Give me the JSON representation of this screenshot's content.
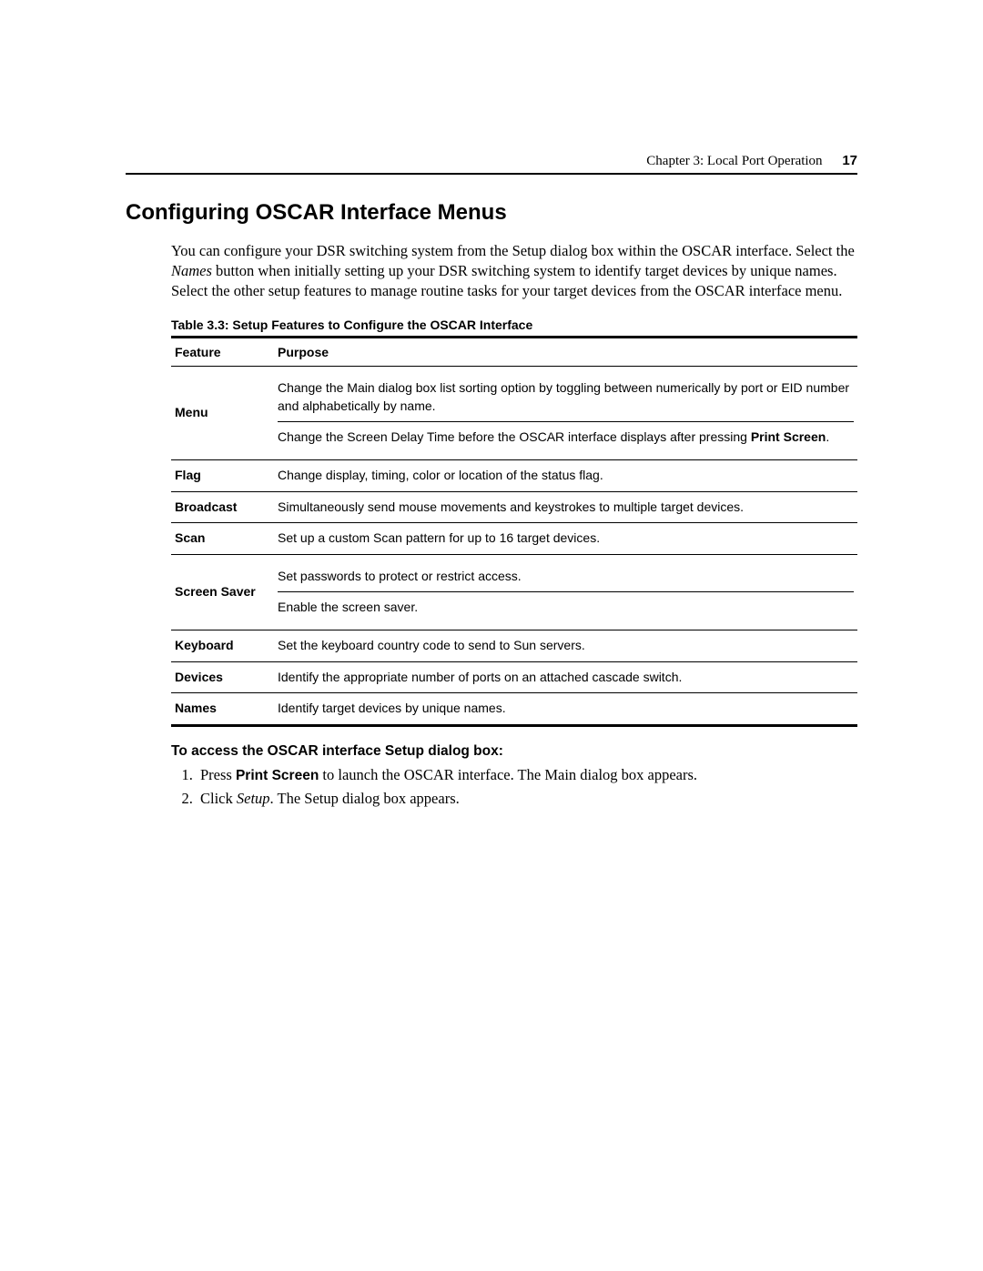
{
  "header": {
    "chapter": "Chapter 3: Local Port Operation",
    "page": "17"
  },
  "title": "Configuring OSCAR Interface Menus",
  "intro": {
    "pre": "You can configure your DSR switching system from the Setup dialog box within the OSCAR interface. Select the ",
    "em": "Names",
    "post": " button when initially setting up your DSR switching system to identify target devices by unique names. Select the other setup features to manage routine tasks for your target devices from the OSCAR interface menu."
  },
  "table": {
    "caption": "Table 3.3: Setup Features to Configure the OSCAR Interface",
    "head_feature": "Feature",
    "head_purpose": "Purpose",
    "rows": [
      {
        "feature": "Menu",
        "purposes": [
          {
            "pre": "Change the Main dialog box list sorting option by toggling between numerically by port or EID number and alphabetically by name.",
            "strong": "",
            "post": ""
          },
          {
            "pre": "Change the Screen Delay Time before the OSCAR interface displays after pressing ",
            "strong": "Print Screen",
            "post": "."
          }
        ]
      },
      {
        "feature": "Flag",
        "purposes": [
          {
            "pre": "Change display, timing, color or location of the status flag.",
            "strong": "",
            "post": ""
          }
        ]
      },
      {
        "feature": "Broadcast",
        "purposes": [
          {
            "pre": "Simultaneously send mouse movements and keystrokes to multiple target devices.",
            "strong": "",
            "post": ""
          }
        ]
      },
      {
        "feature": "Scan",
        "purposes": [
          {
            "pre": "Set up a custom Scan pattern for up to 16 target devices.",
            "strong": "",
            "post": ""
          }
        ]
      },
      {
        "feature": "Screen Saver",
        "purposes": [
          {
            "pre": "Set passwords to protect or restrict access.",
            "strong": "",
            "post": ""
          },
          {
            "pre": "Enable the screen saver.",
            "strong": "",
            "post": ""
          }
        ]
      },
      {
        "feature": "Keyboard",
        "purposes": [
          {
            "pre": "Set the keyboard country code to send to Sun servers.",
            "strong": "",
            "post": ""
          }
        ]
      },
      {
        "feature": "Devices",
        "purposes": [
          {
            "pre": "Identify the appropriate number of ports on an attached cascade switch.",
            "strong": "",
            "post": ""
          }
        ]
      },
      {
        "feature": "Names",
        "purposes": [
          {
            "pre": "Identify target devices by unique names.",
            "strong": "",
            "post": ""
          }
        ]
      }
    ]
  },
  "howto": {
    "title": "To access the OSCAR interface Setup dialog box:",
    "steps": [
      {
        "pre": "Press ",
        "strong": "Print Screen",
        "mid": " to launch the OSCAR interface. The Main dialog box appears.",
        "em": "",
        "post": ""
      },
      {
        "pre": "Click ",
        "strong": "",
        "mid": "",
        "em": "Setup",
        "post": ". The Setup dialog box appears."
      }
    ]
  }
}
